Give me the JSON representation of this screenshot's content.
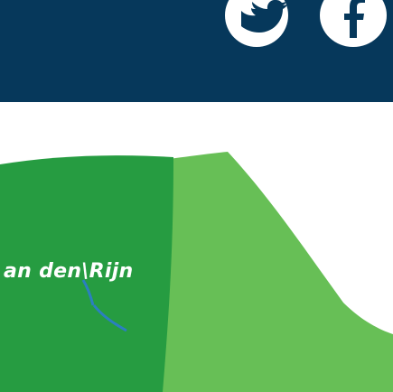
{
  "header": {
    "background": "#06385b",
    "social_icons": [
      {
        "name": "twitter-icon"
      },
      {
        "name": "facebook-icon"
      }
    ]
  },
  "footer": {
    "brand_text": "an den\\Rijn",
    "colors": {
      "dark_green": "#269c41",
      "light_green": "#67bf56",
      "wave_blue": "#2b7fc0"
    }
  }
}
